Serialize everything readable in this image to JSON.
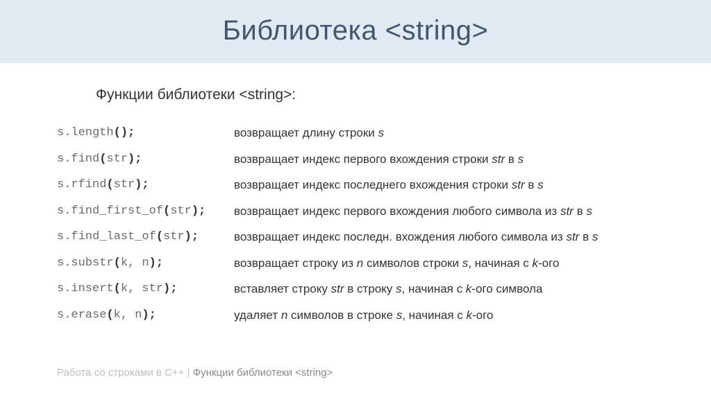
{
  "title": "Библиотека <string>",
  "subtitle": "Функции библиотеки <string>:",
  "rows": [
    {
      "code_html": "s.length<span class='punct'>();</span>",
      "desc_html": "возвращает длину строки <em>s</em>"
    },
    {
      "code_html": "s.find<span class='punct'>(</span>str<span class='punct'>);</span>",
      "desc_html": "возвращает индекс первого вхождения строки <em>str</em> в <em>s</em>"
    },
    {
      "code_html": "s.rfind<span class='punct'>(</span>str<span class='punct'>);</span>",
      "desc_html": "возвращает индекс последнего вхождения строки <em>str</em> в <em>s</em>"
    },
    {
      "code_html": "s.find_first_of<span class='punct'>(</span>str<span class='punct'>);</span>",
      "desc_html": "возвращает индекс первого вхождения любого символа из <em>str</em> в <em>s</em>"
    },
    {
      "code_html": "s.find_last_of<span class='punct'>(</span>str<span class='punct'>);</span>",
      "desc_html": "возвращает индекс последн. вхождения любого символа из <em>str</em> в <em>s</em>"
    },
    {
      "code_html": "s.substr<span class='punct'>(</span>k, n<span class='punct'>);</span>",
      "desc_html": "возвращает строку из <em>n</em> символов строки <em>s</em>, начиная с <em>k</em>-ого"
    },
    {
      "code_html": "s.insert<span class='punct'>(</span>k, str<span class='punct'>);</span>",
      "desc_html": "вставляет строку <em>str</em> в строку <em>s</em>, начиная с <em>k</em>-ого символа"
    },
    {
      "code_html": "s.erase<span class='punct'>(</span>k, n<span class='punct'>);</span>",
      "desc_html": "удаляет <em>n</em> символов в строке <em>s</em>, начиная с <em>k</em>-ого"
    }
  ],
  "footer_light": "Работа со строками в C++ | ",
  "footer_dark": "Функции библиотеки <string>"
}
